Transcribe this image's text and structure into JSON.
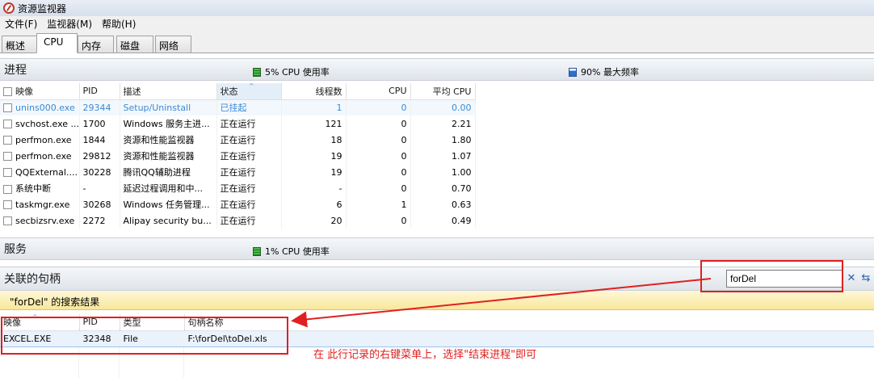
{
  "window": {
    "title": "资源监视器"
  },
  "menu": [
    "文件(F)",
    "监视器(M)",
    "帮助(H)"
  ],
  "tabs": [
    "概述",
    "CPU",
    "内存",
    "磁盘",
    "网络"
  ],
  "process_section": {
    "title": "进程",
    "cpu_meter": "5% CPU 使用率",
    "freq_meter": "90% 最大频率",
    "columns": [
      "映像",
      "PID",
      "描述",
      "状态",
      "线程数",
      "CPU",
      "平均 CPU"
    ],
    "rows": [
      [
        "unins000.exe",
        "29344",
        "Setup/Uninstall",
        "已挂起",
        "1",
        "0",
        "0.00"
      ],
      [
        "svchost.exe ...",
        "1700",
        "Windows 服务主进...",
        "正在运行",
        "121",
        "0",
        "2.21"
      ],
      [
        "perfmon.exe",
        "1844",
        "资源和性能监视器",
        "正在运行",
        "18",
        "0",
        "1.80"
      ],
      [
        "perfmon.exe",
        "29812",
        "资源和性能监视器",
        "正在运行",
        "19",
        "0",
        "1.07"
      ],
      [
        "QQExternal....",
        "30228",
        "腾讯QQ辅助进程",
        "正在运行",
        "19",
        "0",
        "1.00"
      ],
      [
        "系统中断",
        "-",
        "延迟过程调用和中...",
        "正在运行",
        "-",
        "0",
        "0.70"
      ],
      [
        "taskmgr.exe",
        "30268",
        "Windows 任务管理...",
        "正在运行",
        "6",
        "1",
        "0.63"
      ],
      [
        "secbizsrv.exe",
        "2272",
        "Alipay security bu...",
        "正在运行",
        "20",
        "0",
        "0.49"
      ]
    ]
  },
  "services_section": {
    "title": "服务",
    "cpu_meter": "1% CPU 使用率"
  },
  "handles_section": {
    "title": "关联的句柄",
    "search_value": "forDel",
    "result_label": "\"forDel\" 的搜索结果",
    "columns": [
      "映像",
      "PID",
      "类型",
      "句柄名称"
    ],
    "rows": [
      [
        "EXCEL.EXE",
        "32348",
        "File",
        "F:\\forDel\\toDel.xls"
      ]
    ]
  },
  "annotation": "在 此行记录的右键菜单上，选择\"结束进程\"即可",
  "colors": {
    "annotation_red": "#e02020",
    "selected_text": "#3a8ad4",
    "result_bar": "#f8e79a"
  }
}
